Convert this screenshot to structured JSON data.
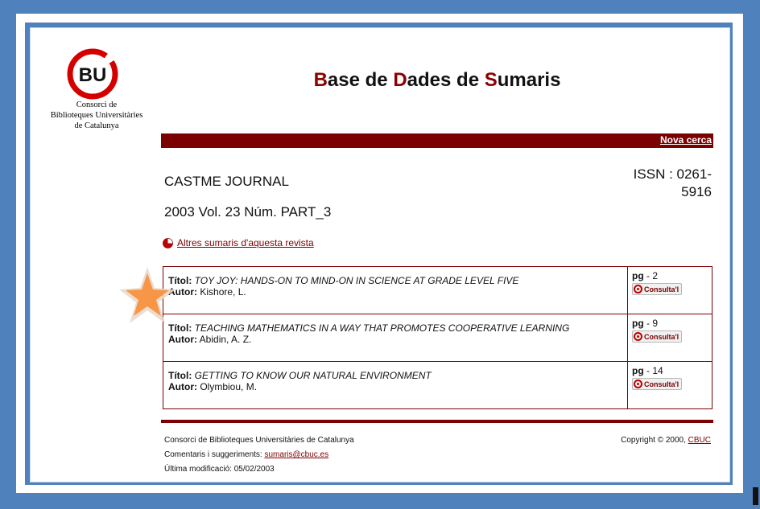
{
  "header": {
    "logo_mark": "BU",
    "logo_line1": "Consorci de",
    "logo_line2": "Biblioteques Universitàries",
    "logo_line3": "de Catalunya",
    "title_parts": [
      "B",
      "ase de ",
      "D",
      "ades de ",
      "S",
      "umaris"
    ],
    "accent_color": "#8b0000"
  },
  "bar": {
    "new_search": "Nova cerca"
  },
  "journal": {
    "name": "CASTME JOURNAL",
    "issue": "2003 Vol. 23 Núm. PART_3",
    "issn_line1": "ISSN : 0261-",
    "issn_line2": "5916",
    "other_link": "Altres sumaris d'aquesta revista",
    "other_icon": "pie-icon"
  },
  "articles": [
    {
      "title_label": "Títol:",
      "title": "TOY JOY: HANDS-ON TO MIND-ON IN SCIENCE AT GRADE LEVEL FIVE",
      "author_label": "Autor:",
      "author": "Kishore, L.",
      "pg_label": "pg",
      "page": "- 2",
      "button": "Consulta'l"
    },
    {
      "title_label": "Títol:",
      "title": "TEACHING MATHEMATICS IN A WAY THAT PROMOTES COOPERATIVE LEARNING",
      "author_label": "Autor:",
      "author": "Abidin, A. Z.",
      "pg_label": "pg",
      "page": "- 9",
      "button": "Consulta'l"
    },
    {
      "title_label": "Títol:",
      "title": "GETTING TO KNOW OUR NATURAL ENVIRONMENT",
      "author_label": "Autor:",
      "author": "Olymbiou, M.",
      "pg_label": "pg",
      "page": "- 14",
      "button": "Consulta'l"
    }
  ],
  "footer": {
    "org": "Consorci de Biblioteques Universitàries de Catalunya",
    "comments_label": "Comentaris i suggeriments: ",
    "comments_email": "sumaris@cbuc.es",
    "modified": "Última modificació: 05/02/2003",
    "copyright_label": "Copyright © 2000, ",
    "copyright_link": "CBUC"
  },
  "colors": {
    "frame": "#4f81bd",
    "bar": "#7b0000",
    "star": "#f79646"
  }
}
